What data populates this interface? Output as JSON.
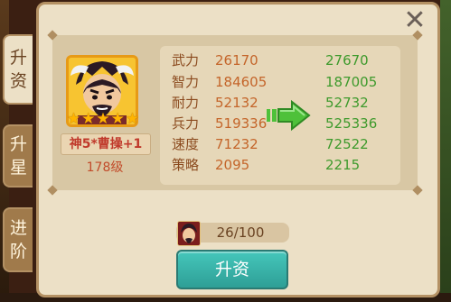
{
  "tabs": [
    {
      "label_line1": "升",
      "label_line2": "资"
    },
    {
      "label_line1": "升",
      "label_line2": "星"
    },
    {
      "label_line1": "进",
      "label_line2": "阶"
    }
  ],
  "close_icon": "close-icon",
  "hero": {
    "name": "神5*曹操+1",
    "level": "178级",
    "stars": 5
  },
  "stats": [
    {
      "label": "武力",
      "current": "26170",
      "next": "27670"
    },
    {
      "label": "智力",
      "current": "184605",
      "next": "187005"
    },
    {
      "label": "耐力",
      "current": "52132",
      "next": "52732"
    },
    {
      "label": "兵力",
      "current": "519336",
      "next": "525336"
    },
    {
      "label": "速度",
      "current": "71232",
      "next": "72522"
    },
    {
      "label": "策略",
      "current": "2095",
      "next": "2215"
    }
  ],
  "material": {
    "count": "26/100"
  },
  "upgrade_button": "升资",
  "colors": {
    "accent_button": "#3bb5ab",
    "stat_next": "#3e9a2c",
    "stat_current": "#c4652a"
  }
}
